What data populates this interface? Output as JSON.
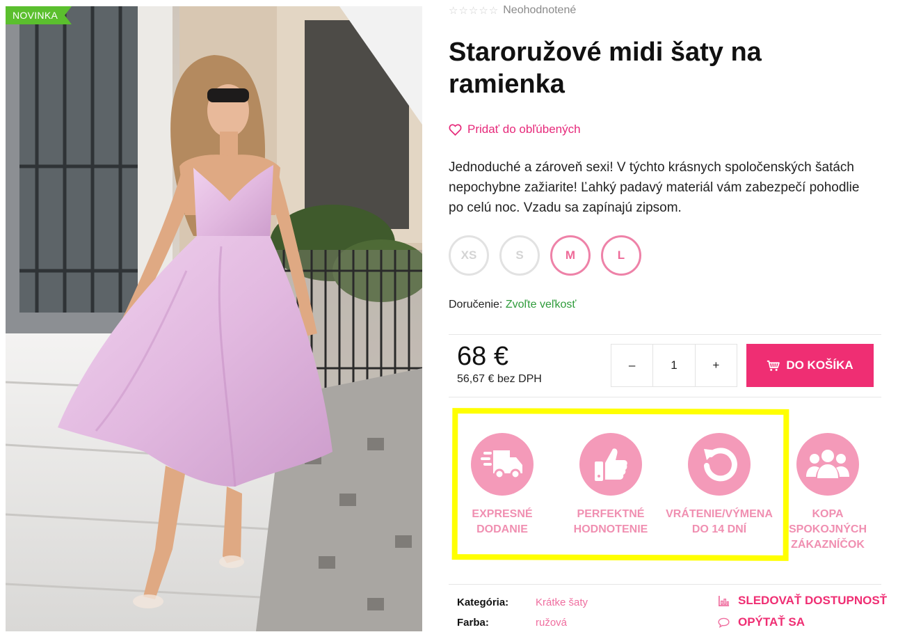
{
  "badge": "NOVINKA",
  "rating": {
    "stars": "☆☆☆☆☆",
    "text": "Neohodnotené"
  },
  "product": {
    "title": "Staroružové midi šaty na ramienka",
    "favorite": "Pridať do obľúbených",
    "description": "Jednoduché a zároveň sexi! V týchto krásnych spoločenských šatách nepochybne zažiarite!  Ľahký padavý materiál vám zabezpečí pohodlie po celú noc. Vzadu sa zapínajú zipsom."
  },
  "sizes": [
    {
      "label": "XS",
      "available": false
    },
    {
      "label": "S",
      "available": false
    },
    {
      "label": "M",
      "available": true
    },
    {
      "label": "L",
      "available": true
    }
  ],
  "delivery": {
    "label": "Doručenie:",
    "value": "Zvoľte veľkosť"
  },
  "price": {
    "main": "68 €",
    "net": "56,67 € bez DPH"
  },
  "quantity": {
    "minus": "–",
    "value": "1",
    "plus": "+"
  },
  "cart_button": "DO KOŠÍKA",
  "benefits": [
    {
      "line1": "EXPRESNÉ",
      "line2": "DODANIE",
      "line3": "",
      "icon": "truck-icon"
    },
    {
      "line1": "PERFEKTNÉ",
      "line2": "HODNOTENIE",
      "line3": "",
      "icon": "thumbs-up-icon"
    },
    {
      "line1": "VRÁTENIE/VÝMENA",
      "line2": "DO 14 DNÍ",
      "line3": "",
      "icon": "return-icon"
    },
    {
      "line1": "KOPA",
      "line2": "SPOKOJNÝCH",
      "line3": "ZÁKAZNÍČOK",
      "icon": "customers-icon"
    }
  ],
  "meta": [
    {
      "key": "Kategória:",
      "value": "Krátke šaty"
    },
    {
      "key": "Farba:",
      "value": "ružová"
    }
  ],
  "actions": {
    "watch": "SLEDOVAŤ DOSTUPNOSŤ",
    "ask": "OPÝTAŤ SA"
  },
  "colors": {
    "accent": "#ef2e73",
    "benefit": "#f49ab9",
    "highlight": "#ffff00",
    "badge": "#5bbf2e"
  }
}
